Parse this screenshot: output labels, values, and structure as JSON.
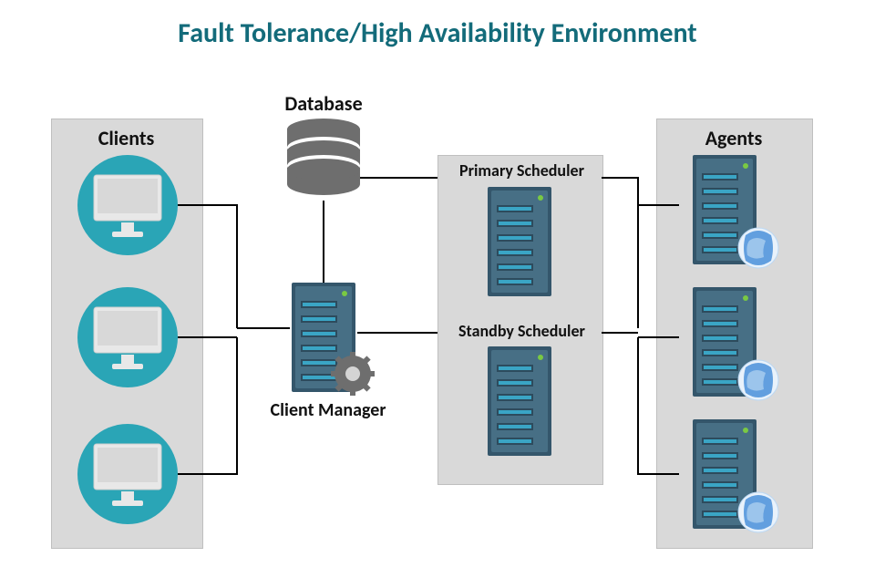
{
  "title": "Fault Tolerance/High Availability Environment",
  "labels": {
    "clients": "Clients",
    "database": "Database",
    "client_manager": "Client Manager",
    "primary_scheduler": "Primary Scheduler",
    "standby_scheduler": "Standby Scheduler",
    "agents": "Agents"
  },
  "columns": {
    "clients": {
      "label": "Clients",
      "items": [
        "client-1",
        "client-2",
        "client-3"
      ]
    },
    "schedulers": {
      "items": [
        "Primary Scheduler",
        "Standby Scheduler"
      ]
    },
    "agents": {
      "label": "Agents",
      "items": [
        "agent-1",
        "agent-2",
        "agent-3"
      ]
    }
  },
  "middle": {
    "database": "Database",
    "client_manager": "Client Manager"
  },
  "links": [
    "client-1 → client-manager",
    "client-2 → client-manager",
    "client-3 → client-manager",
    "client-manager → database",
    "database → primary-scheduler",
    "client-manager → standby-scheduler",
    "primary-scheduler → agent-1",
    "primary-scheduler → agent-2",
    "standby-scheduler → agent-3"
  ],
  "colors": {
    "title": "#136b7a",
    "panel": "#d9d9d9",
    "line": "#000",
    "server": "#2f556b",
    "accent": "#3aa5c5",
    "monitor": "#e8e8e8",
    "db": "#6e6e6e"
  }
}
